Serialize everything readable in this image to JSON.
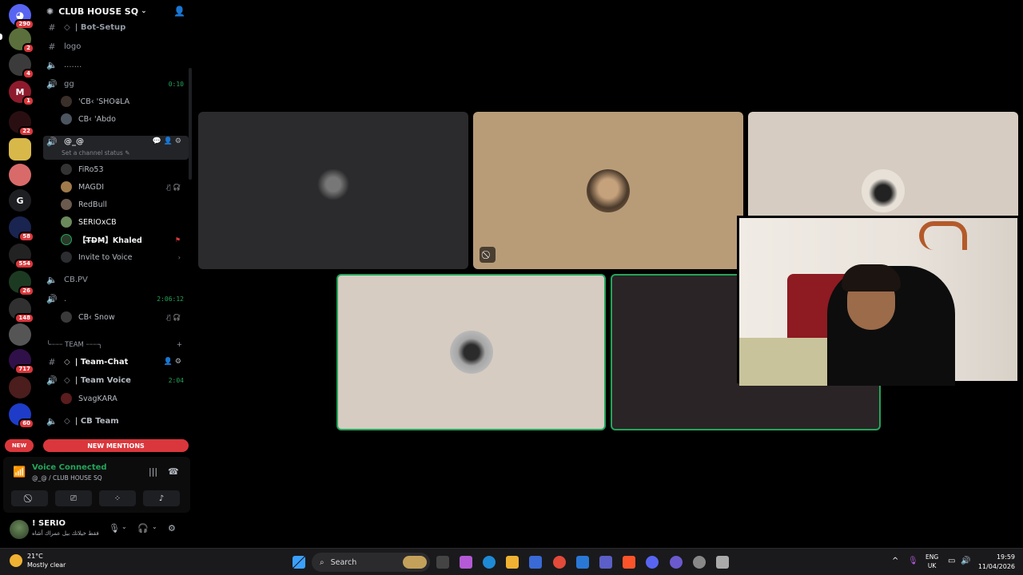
{
  "server": {
    "name": "CLUB HOUSE SQ"
  },
  "rail_badges": [
    "290",
    "2",
    "4",
    "1",
    "22",
    "58",
    "554",
    "26",
    "148",
    "717",
    "60"
  ],
  "rail_letter": "G",
  "channels": {
    "bot_setup": "| Bot-Setup",
    "logo": "logo",
    "dots": ".......",
    "gg": {
      "name": "gg",
      "time": "0:10",
      "users": [
        "'CB‹ 'SHO𝕾LA",
        "CB‹ 'Abdo"
      ]
    },
    "active": {
      "name": "@_@",
      "status_hint": "Set a channel status",
      "users": [
        "FiRo53",
        "MAGDI",
        "RedBull",
        "SERIOxCB",
        "【T̶D̶M̶】Khaled"
      ],
      "invite": "Invite to Voice"
    },
    "cbpv": "CB.PV",
    "dot_voice": {
      "name": ".",
      "time": "2:06:12",
      "users": [
        "CB‹ Snow"
      ]
    },
    "team_category": "╰┈┈┈ TEAM ┈┈┈╮",
    "team_chat": "| Team-Chat",
    "team_voice": {
      "name": "| Team Voice",
      "time": "2:04",
      "users": [
        "SvagKARA"
      ]
    },
    "cb_team": "| CB Team"
  },
  "mentions": {
    "new": "NEW",
    "label": "NEW MENTIONS"
  },
  "voice": {
    "title": "Voice Connected",
    "sub": "@_@ / CLUB HOUSE SQ"
  },
  "user": {
    "name": "! SERIO",
    "status": "فقط خيلاتك بيل عمراك أشاه"
  },
  "taskbar": {
    "weather_temp": "21°C",
    "weather_desc": "Mostly clear",
    "search": "Search",
    "lang1": "ENG",
    "lang2": "UK",
    "time": "19:59",
    "date": "11/04/2026"
  },
  "colors": {
    "speaking": "#23a559",
    "mention": "#da373c",
    "tile_tan": "#b89c78",
    "tile_beige": "#d6ccc1"
  }
}
